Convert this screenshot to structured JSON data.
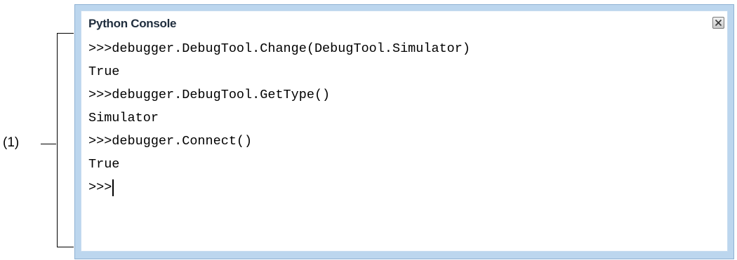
{
  "callout": {
    "label": "(1)"
  },
  "panel": {
    "title": "Python Console",
    "close_icon": "close-icon"
  },
  "console": {
    "lines": [
      ">>>debugger.DebugTool.Change(DebugTool.Simulator)",
      "True",
      ">>>debugger.DebugTool.GetType()",
      "Simulator",
      ">>>debugger.Connect()",
      "True"
    ],
    "prompt": ">>>"
  },
  "colors": {
    "panel_frame": "#bcd6ee",
    "title_text": "#1f2d3d"
  }
}
